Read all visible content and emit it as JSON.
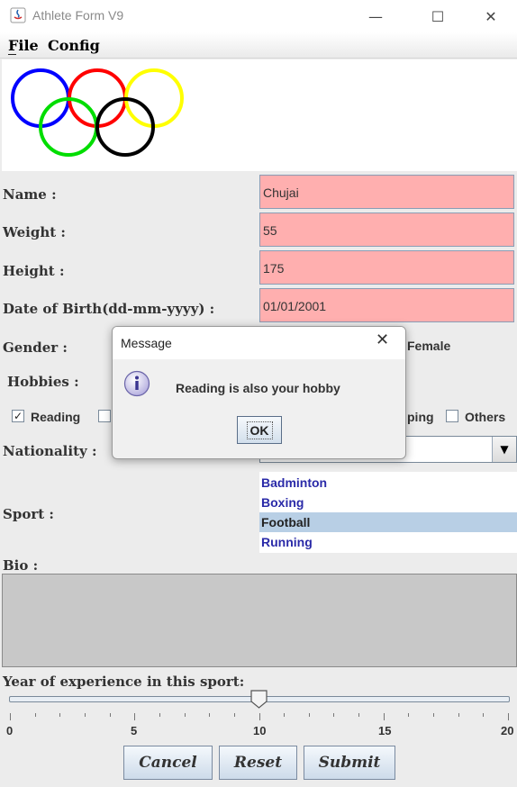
{
  "window": {
    "title": "Athlete Form V9",
    "minimize": "—",
    "maximize": "☐",
    "close": "✕"
  },
  "menu": {
    "file": "File",
    "config": "Config"
  },
  "form": {
    "name_label": "Name :",
    "name_value": "Chujai",
    "weight_label": "Weight :",
    "weight_value": "55",
    "height_label": "Height :",
    "height_value": "175",
    "dob_label": "Date of Birth(dd-mm-yyyy) :",
    "dob_value": "01/01/2001",
    "gender_label": "Gender :",
    "gender_female": "Female",
    "hobbies_label": "Hobbies :",
    "hobby_reading": "Reading",
    "hobby_reading_checked": true,
    "hobby_partial": "ping",
    "hobby_others": "Others",
    "nationality_label": "Nationality :",
    "sport_label": "Sport :",
    "sports": [
      "Badminton",
      "Boxing",
      "Football",
      "Running"
    ],
    "sport_selected": "Football",
    "bio_label": "Bio :",
    "experience_label": "Year of experience in this sport:",
    "experience_value": 10,
    "slider_min": 0,
    "slider_max": 20,
    "slider_labels": [
      "0",
      "5",
      "10",
      "15",
      "20"
    ]
  },
  "buttons": {
    "cancel": "Cancel",
    "reset": "Reset",
    "submit": "Submit"
  },
  "dialog": {
    "title": "Message",
    "close": "✕",
    "message": "Reading is also your hobby",
    "ok": "OK"
  },
  "colors": {
    "field_bg": "#ffafaf",
    "list_selected": "#b8cfe5",
    "list_text": "#2a2aa8",
    "bio_bg": "#c8c8c8"
  },
  "rings": [
    "blue",
    "red",
    "yellow",
    "green",
    "black"
  ]
}
